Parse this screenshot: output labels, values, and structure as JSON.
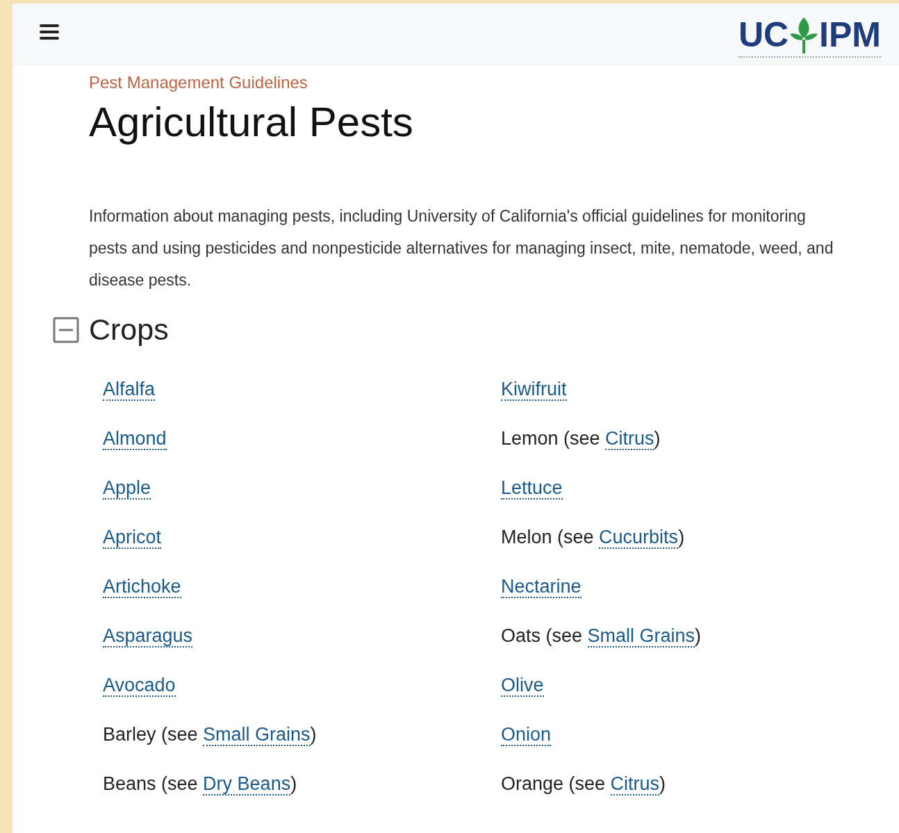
{
  "header": {
    "logo": {
      "left": "UC",
      "right": "IPM"
    }
  },
  "breadcrumb": "Pest Management Guidelines",
  "title": "Agricultural Pests",
  "intro": "Information about managing pests, including University of California's official guidelines for monitoring pests and using pesticides and nonpesticide alternatives for managing insect, mite, nematode, weed, and disease pests.",
  "section": {
    "title": "Crops",
    "expanded": true,
    "columns": [
      [
        {
          "kind": "link",
          "label": "Alfalfa"
        },
        {
          "kind": "link",
          "label": "Almond"
        },
        {
          "kind": "link",
          "label": "Apple"
        },
        {
          "kind": "link",
          "label": "Apricot"
        },
        {
          "kind": "link",
          "label": "Artichoke"
        },
        {
          "kind": "link",
          "label": "Asparagus"
        },
        {
          "kind": "link",
          "label": "Avocado"
        },
        {
          "kind": "see",
          "label": "Barley (see ",
          "link": "Small Grains",
          "after": ")"
        },
        {
          "kind": "see",
          "label": "Beans (see ",
          "link": "Dry Beans",
          "after": ")"
        }
      ],
      [
        {
          "kind": "link",
          "label": "Kiwifruit"
        },
        {
          "kind": "see",
          "label": "Lemon (see ",
          "link": "Citrus",
          "after": ")"
        },
        {
          "kind": "link",
          "label": "Lettuce"
        },
        {
          "kind": "see",
          "label": "Melon (see ",
          "link": "Cucurbits",
          "after": ")"
        },
        {
          "kind": "link",
          "label": "Nectarine"
        },
        {
          "kind": "see",
          "label": "Oats (see ",
          "link": "Small Grains",
          "after": ")"
        },
        {
          "kind": "link",
          "label": "Olive"
        },
        {
          "kind": "link",
          "label": "Onion"
        },
        {
          "kind": "see",
          "label": "Orange (see ",
          "link": "Citrus",
          "after": ")"
        }
      ]
    ]
  }
}
